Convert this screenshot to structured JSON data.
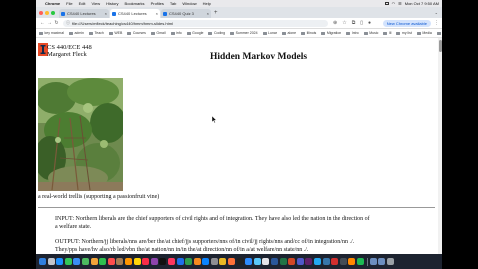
{
  "menubar": {
    "apple_glyph": "",
    "items": [
      "Chrome",
      "File",
      "Edit",
      "View",
      "History",
      "Bookmarks",
      "Profiles",
      "Tab",
      "Window",
      "Help"
    ],
    "datetime": "Mon Oct 7  9:50 AM"
  },
  "tabs": [
    {
      "title": "CS440 Lectures",
      "active": false
    },
    {
      "title": "CS440 Lectures",
      "active": true
    },
    {
      "title": "CS440 Quiz 3",
      "active": false
    }
  ],
  "toolbar": {
    "url": "file:///Users/mfleck/teaching/cs440/hmm/hmm-slides.html",
    "update_label": "New Chrome available"
  },
  "bookmarks": {
    "items": [
      "key maximal",
      "admin",
      "Teach",
      "WEB",
      "Courses",
      "Gmail",
      "info",
      "Google",
      "Coding",
      "Summer 2024",
      "Lunar",
      "alone",
      "Illinois",
      "Migration",
      "Intro",
      "Music",
      "Ill",
      "my list",
      "Media"
    ],
    "all_label": "All Bookmarks"
  },
  "page": {
    "course_line1": "CS 440/ECE 448",
    "course_line2": "Margaret Fleck",
    "title": "Hidden Markov Models",
    "caption": "a real-world trellis (supporting a passionfruit vine)",
    "input_line1": "INPUT: Northern liberals are the chief supporters of civil rights and of integration. They have also led the nation in the direction of",
    "input_line2": "a welfare state.",
    "output_line1": "OUTPUT: Northern/jj liberals/nns are/ber the/at chief/jjs supporters/nns of/in civil/jj rights/nns and/cc of/in integration/nn ./.",
    "output_line2": "They/pps have/hv also/rb led/vbn the/at nation/nn in/in the/at direction/nn of/in a/at welfare/nn state/nn ./."
  },
  "colors": {
    "illinois_orange": "#e84a27",
    "illinois_blue": "#13294b",
    "dock_bg": "#1d2330"
  },
  "dock_icons": [
    "finder-icon",
    "launchpad-icon",
    "safari-icon",
    "messages-icon",
    "mail-icon",
    "maps-icon",
    "photos-icon",
    "facetime-icon",
    "calendar-icon",
    "contacts-icon",
    "reminders-icon",
    "notes-icon",
    "music-icon",
    "podcasts-icon",
    "tv-icon",
    "news-icon",
    "keynote-icon",
    "numbers-icon",
    "pages-icon",
    "app-store-icon",
    "system-settings-icon",
    "chrome-icon",
    "firefox-icon",
    "terminal-icon",
    "zoom-icon",
    "preview-icon",
    "textedit-icon",
    "word-icon",
    "excel-icon",
    "powerpoint-icon",
    "teams-icon",
    "slack-icon",
    "vscode-icon",
    "python-icon",
    "acrobat-icon",
    "quicktime-icon",
    "vlc-icon",
    "spotify-icon",
    "downloads-icon",
    "documents-icon",
    "trash-icon"
  ]
}
